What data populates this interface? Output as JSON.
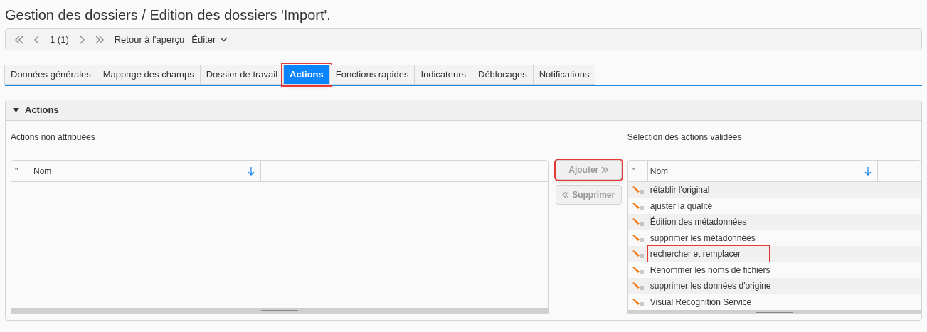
{
  "title": "Gestion des dossiers / Edition des dossiers 'Import'.",
  "toolbar": {
    "page": "1 (1)",
    "back_link": "Retour à l'aperçu",
    "edit_menu": "Éditer"
  },
  "tabs": [
    {
      "label": "Données générales",
      "selected": false,
      "highlighted": false
    },
    {
      "label": "Mappage des champs",
      "selected": false,
      "highlighted": false
    },
    {
      "label": "Dossier de travail",
      "selected": false,
      "highlighted": false
    },
    {
      "label": "Actions",
      "selected": true,
      "highlighted": true
    },
    {
      "label": "Fonctions rapides",
      "selected": false,
      "highlighted": false
    },
    {
      "label": "Indicateurs",
      "selected": false,
      "highlighted": false
    },
    {
      "label": "Déblocages",
      "selected": false,
      "highlighted": false
    },
    {
      "label": "Notifications",
      "selected": false,
      "highlighted": false
    }
  ],
  "section": {
    "title": "Actions",
    "expanded": true
  },
  "left_list": {
    "label": "Actions non attribuées",
    "columns": [
      "\"",
      "Nom"
    ]
  },
  "buttons": [
    {
      "label": "Ajouter",
      "kind": "add",
      "disabled": true,
      "highlighted": true
    },
    {
      "label": "Supprimer",
      "kind": "remove",
      "disabled": true,
      "highlighted": false
    }
  ],
  "right_list": {
    "label": "Sélection des actions validées",
    "columns": [
      "\"",
      "Nom"
    ],
    "rows": [
      {
        "name": "rétablir l'original",
        "highlighted": false
      },
      {
        "name": "ajuster la qualité",
        "highlighted": false
      },
      {
        "name": "Édition des métadonnées",
        "highlighted": false
      },
      {
        "name": "supprimer les métadonnées",
        "highlighted": false
      },
      {
        "name": "rechercher et remplacer",
        "highlighted": true
      },
      {
        "name": "Renommer les noms de fichiers",
        "highlighted": false
      },
      {
        "name": "supprimer les données d'origine",
        "highlighted": false
      },
      {
        "name": "Visual Recognition Service",
        "highlighted": false
      }
    ]
  }
}
